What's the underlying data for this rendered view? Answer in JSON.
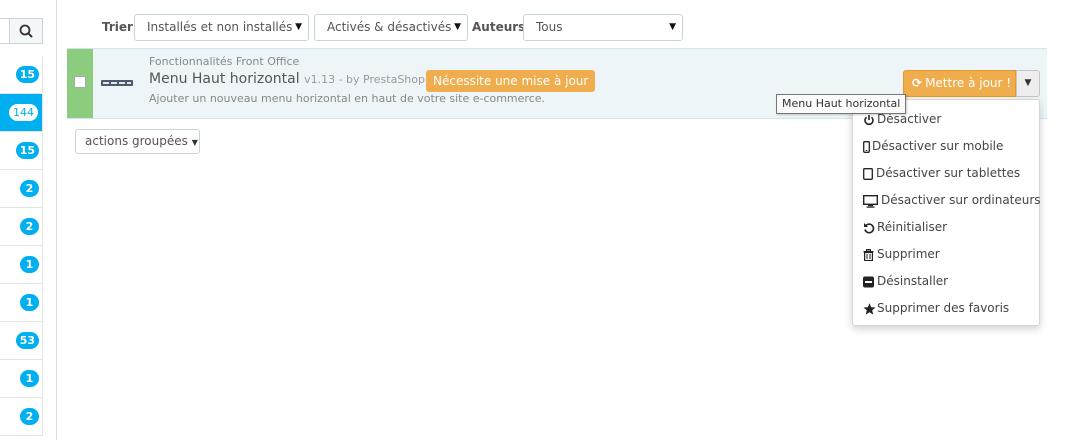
{
  "sidebar": {
    "search_icon": "search-icon",
    "counts": [
      "15",
      "144",
      "15",
      "2",
      "2",
      "1",
      "1",
      "53",
      "1",
      "2"
    ],
    "active_index": 1,
    "accent_color": "#00aff0"
  },
  "filters": {
    "sort_label": "Trier",
    "install_value": "Installés et non installés",
    "status_value": "Activés & désactivés",
    "authors_label": "Auteurs",
    "authors_value": "Tous"
  },
  "module": {
    "category": "Fonctionnalités Front Office",
    "name": "Menu Haut horizontal",
    "version": "v1.13 - by PrestaShop",
    "update_badge": "Nécessite une mise à jour",
    "description": "Ajouter un nouveau menu horizontal en haut de votre site e-commerce.",
    "update_button": "Mettre à jour !",
    "tooltip": "Menu Haut horizontal",
    "status_color": "#8ccc7f",
    "warning_color": "#f0ad4e"
  },
  "dropdown": {
    "items": [
      {
        "label": "Désactiver",
        "icon": "power-icon"
      },
      {
        "label": "Désactiver sur mobile",
        "icon": "mobile-icon"
      },
      {
        "label": "Désactiver sur tablettes",
        "icon": "tablet-icon"
      },
      {
        "label": "Désactiver sur ordinateurs",
        "icon": "desktop-icon"
      },
      {
        "label": "Réinitialiser",
        "icon": "undo-icon"
      },
      {
        "label": "Supprimer",
        "icon": "trash-icon"
      },
      {
        "label": "Désinstaller",
        "icon": "minus-square-icon"
      },
      {
        "label": "Supprimer des favoris",
        "icon": "star-icon"
      }
    ]
  },
  "bulk": {
    "label": "actions groupées"
  }
}
